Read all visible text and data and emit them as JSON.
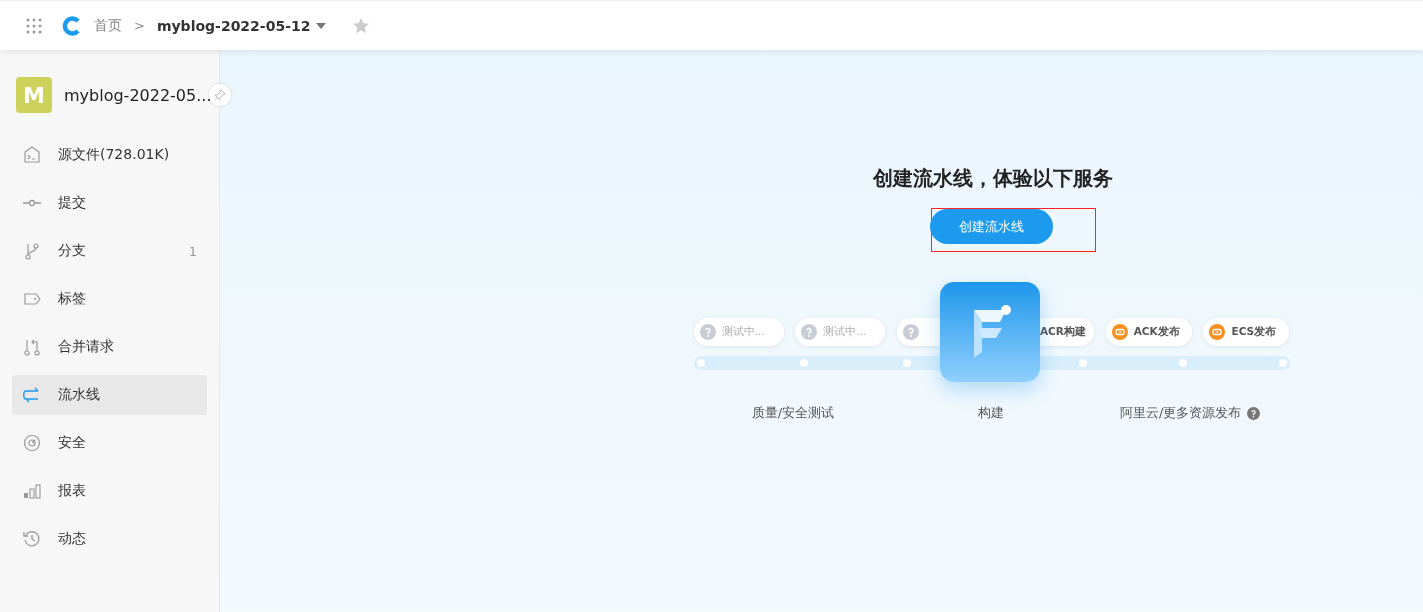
{
  "header": {
    "home": "首页",
    "separator": ">",
    "repo": "myblog-2022-05-12",
    "starred": false
  },
  "project": {
    "avatar": "M",
    "name": "myblog-2022-05..."
  },
  "sidebar": {
    "items": [
      {
        "label": "源文件(728.01K)",
        "selected": false
      },
      {
        "label": "提交",
        "selected": false
      },
      {
        "label": "分支",
        "selected": false,
        "count": "1"
      },
      {
        "label": "标签",
        "selected": false
      },
      {
        "label": "合并请求",
        "selected": false
      },
      {
        "label": "流水线",
        "selected": true
      },
      {
        "label": "安全",
        "selected": false
      },
      {
        "label": "报表",
        "selected": false
      },
      {
        "label": "动态",
        "selected": false
      }
    ]
  },
  "main": {
    "title": "创建流水线，体验以下服务",
    "button": "创建流水线",
    "highlighted": true,
    "chips": [
      {
        "kind": "test",
        "label": "测试中..."
      },
      {
        "kind": "test",
        "label": "测试中..."
      },
      {
        "kind": "test"
      },
      {
        "kind": "build",
        "label": "ACR构建"
      },
      {
        "kind": "deploy",
        "label": "ACK发布"
      },
      {
        "kind": "deploy",
        "label": "ECS发布"
      }
    ],
    "stages": [
      {
        "label": "质量/安全测试"
      },
      {
        "label": "构建"
      },
      {
        "label": "阿里云/更多资源发布",
        "help": true
      }
    ]
  }
}
